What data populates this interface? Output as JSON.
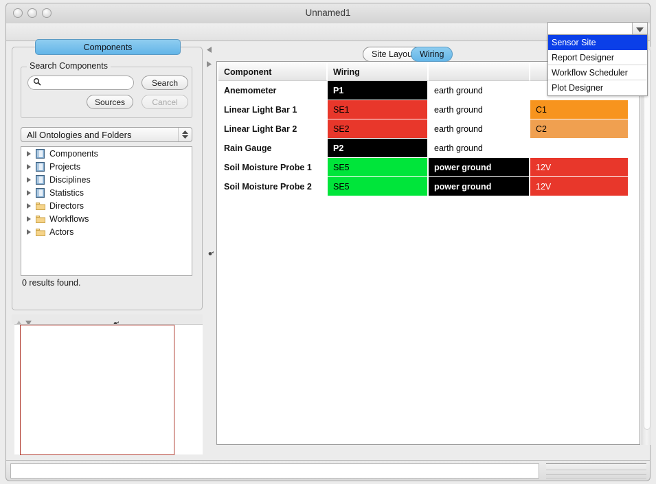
{
  "window": {
    "title": "Unnamed1",
    "traffic_lights": [
      "close-button",
      "minimize-button",
      "zoom-button"
    ]
  },
  "perspective_combo": {
    "value": "",
    "icon": "chevron-down-icon",
    "options": [
      "Sensor Site",
      "Report Designer",
      "Workflow Scheduler",
      "Plot Designer"
    ],
    "selected_index": 0,
    "selected_color": "#0b3fe8"
  },
  "left_panel": {
    "tab_label": "Components",
    "tab_color": "#63b5e8",
    "search_group": {
      "legend": "Search Components",
      "search_input": {
        "value": "",
        "placeholder": "",
        "icon": "search-icon"
      },
      "buttons": [
        {
          "name": "search-button",
          "label": "Search",
          "disabled": false
        },
        {
          "name": "sources-button",
          "label": "Sources",
          "disabled": false
        },
        {
          "name": "cancel-button",
          "label": "Cancel",
          "disabled": true
        }
      ]
    },
    "ontology_combo": {
      "value": "All Ontologies and Folders",
      "icon": "stepper-icon"
    },
    "tree_items": [
      {
        "label": "Components",
        "icon": "book-icon",
        "expanded": false
      },
      {
        "label": "Projects",
        "icon": "book-icon",
        "expanded": false
      },
      {
        "label": "Disciplines",
        "icon": "book-icon",
        "expanded": false
      },
      {
        "label": "Statistics",
        "icon": "book-icon",
        "expanded": false
      },
      {
        "label": "Directors",
        "icon": "folder-icon",
        "expanded": false
      },
      {
        "label": "Workflows",
        "icon": "folder-icon",
        "expanded": false
      },
      {
        "label": "Actors",
        "icon": "folder-icon",
        "expanded": false
      }
    ],
    "results_text": "0 results found."
  },
  "preview_panel": {
    "up_icon": "triangle-up-icon",
    "down_icon": "triangle-down-icon",
    "grip_icon": "grip-icon",
    "selection_outline_color": "#b03a2e"
  },
  "splitter": {
    "left_arrow_icon": "triangle-left-icon",
    "right_arrow_icon": "triangle-right-icon",
    "grip_icon": "grip-icon"
  },
  "main_panel": {
    "tabs": [
      {
        "label": "Site Layout",
        "active": false
      },
      {
        "label": "Wiring",
        "active": true
      }
    ],
    "table": {
      "headers": [
        "Component",
        "Wiring",
        "",
        ""
      ],
      "rows": [
        {
          "component": "Anemometer",
          "cells": [
            {
              "text": "P1",
              "bg": "#000000",
              "fg": "#ffffff",
              "bold": true
            },
            {
              "text": "earth ground",
              "bg": "#ffffff",
              "fg": "#000000",
              "bold": false
            },
            {
              "text": "",
              "bg": "#ffffff",
              "fg": "#000000",
              "bold": false
            }
          ]
        },
        {
          "component": "Linear Light Bar 1",
          "cells": [
            {
              "text": "SE1",
              "bg": "#e8372b",
              "fg": "#000000",
              "bold": false
            },
            {
              "text": "earth ground",
              "bg": "#ffffff",
              "fg": "#000000",
              "bold": false
            },
            {
              "text": "C1",
              "bg": "#f7941e",
              "fg": "#000000",
              "bold": false
            }
          ]
        },
        {
          "component": "Linear Light Bar 2",
          "cells": [
            {
              "text": "SE2",
              "bg": "#e8372b",
              "fg": "#000000",
              "bold": false
            },
            {
              "text": "earth ground",
              "bg": "#ffffff",
              "fg": "#000000",
              "bold": false
            },
            {
              "text": "C2",
              "bg": "#f0a050",
              "fg": "#000000",
              "bold": false
            }
          ]
        },
        {
          "component": "Rain Gauge",
          "cells": [
            {
              "text": "P2",
              "bg": "#000000",
              "fg": "#ffffff",
              "bold": true
            },
            {
              "text": "earth ground",
              "bg": "#ffffff",
              "fg": "#000000",
              "bold": false
            },
            {
              "text": "",
              "bg": "#ffffff",
              "fg": "#000000",
              "bold": false
            }
          ]
        },
        {
          "component": "Soil Moisture Probe 1",
          "cells": [
            {
              "text": "SE5",
              "bg": "#00e53a",
              "fg": "#000000",
              "bold": false
            },
            {
              "text": "power ground",
              "bg": "#000000",
              "fg": "#ffffff",
              "bold": true
            },
            {
              "text": "12V",
              "bg": "#e8372b",
              "fg": "#ffffff",
              "bold": false
            }
          ]
        },
        {
          "component": "Soil Moisture Probe 2",
          "cells": [
            {
              "text": "SE5",
              "bg": "#00e53a",
              "fg": "#000000",
              "bold": false
            },
            {
              "text": "power ground",
              "bg": "#000000",
              "fg": "#ffffff",
              "bold": true
            },
            {
              "text": "12V",
              "bg": "#e8372b",
              "fg": "#ffffff",
              "bold": false
            }
          ]
        }
      ]
    }
  },
  "status_bar": {
    "text": ""
  }
}
